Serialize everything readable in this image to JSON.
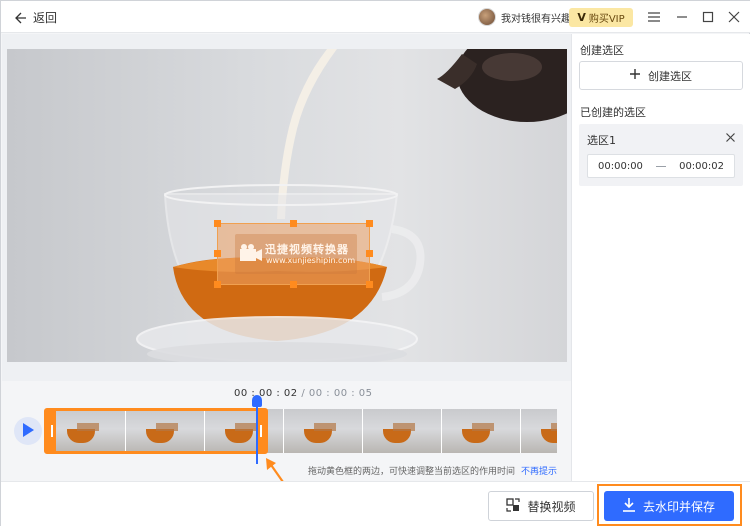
{
  "header": {
    "back_label": "返回",
    "username": "我对钱很有兴趣",
    "vip_badge": "V",
    "vip_label": "购买VIP"
  },
  "video": {
    "watermark_title": "迅捷视频转换器",
    "watermark_url": "www.xunjieshipin.com"
  },
  "panel": {
    "create_heading": "创建选区",
    "create_button": "创建选区",
    "created_heading": "已创建的选区",
    "regions": [
      {
        "name": "选区1",
        "start": "00:00:00",
        "end": "00:00:02"
      }
    ]
  },
  "timeline": {
    "current": "00 : 00 : 02",
    "separator": " / ",
    "duration": "00 : 00 : 05",
    "hint": "拖动黄色框的两边，可快速调整当前选区的作用时间",
    "hint_link": "不再提示",
    "frame_count": 7
  },
  "footer": {
    "replace_label": "替换视频",
    "save_label": "去水印并保存"
  },
  "colors": {
    "accent": "#2f6bff",
    "highlight": "#ff8b1e",
    "vip_bg": "#fbe7a3"
  },
  "icons": [
    "back-arrow-icon",
    "avatar",
    "vip-icon",
    "menu-icon",
    "minimize-icon",
    "maximize-icon",
    "close-icon",
    "plus-icon",
    "play-icon",
    "replace-icon",
    "download-icon"
  ]
}
